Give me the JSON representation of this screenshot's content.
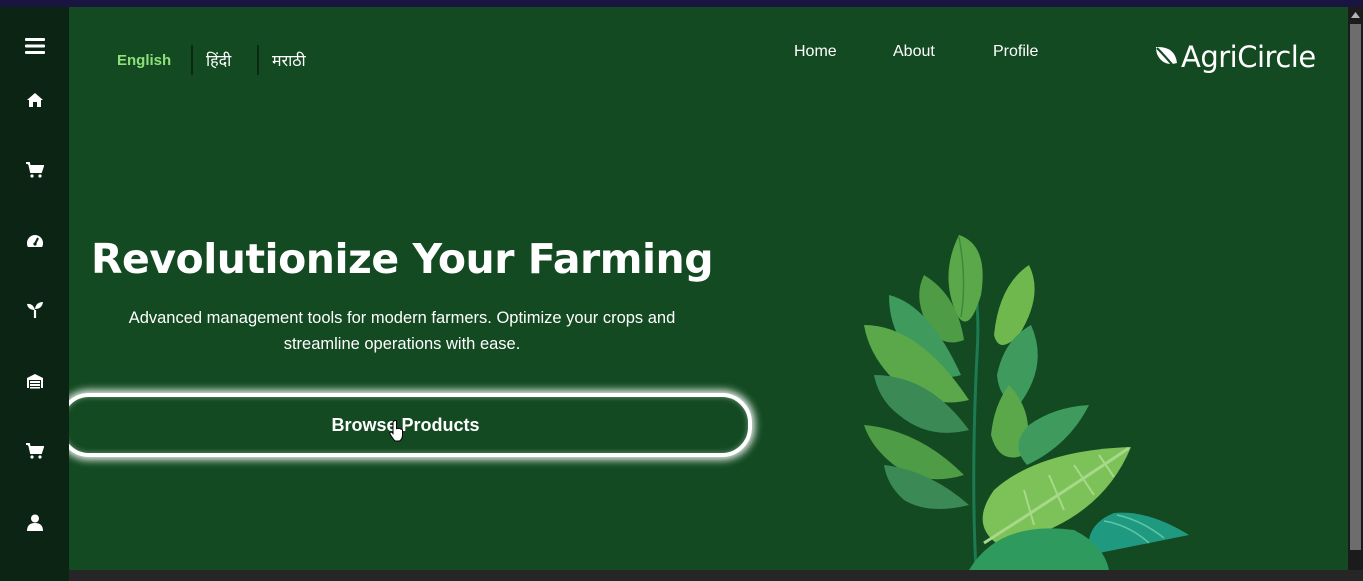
{
  "app": {
    "name": "AgriCircle",
    "colors": {
      "background": "#134a22",
      "sidebar": "#0b2414",
      "accent": "#8fe07a",
      "text": "#ffffff"
    }
  },
  "sidebar": {
    "items": [
      {
        "icon": "menu-icon"
      },
      {
        "icon": "home-icon"
      },
      {
        "icon": "cart-icon"
      },
      {
        "icon": "dashboard-icon"
      },
      {
        "icon": "seedling-icon"
      },
      {
        "icon": "warehouse-icon"
      },
      {
        "icon": "cart-icon"
      },
      {
        "icon": "user-icon"
      }
    ]
  },
  "languages": {
    "items": [
      {
        "label": "English",
        "active": true
      },
      {
        "label": "हिंदी",
        "active": false
      },
      {
        "label": "मराठी",
        "active": false
      }
    ]
  },
  "nav": {
    "links": [
      {
        "label": "Home"
      },
      {
        "label": "About"
      },
      {
        "label": "Profile"
      }
    ]
  },
  "logo": {
    "text": "AgriCircle",
    "icon": "leaf-icon"
  },
  "hero": {
    "title": "Revolutionize Your Farming",
    "subtitle": "Advanced management tools for modern farmers. Optimize your crops and streamline operations with ease.",
    "cta_label": "Browse Products"
  }
}
